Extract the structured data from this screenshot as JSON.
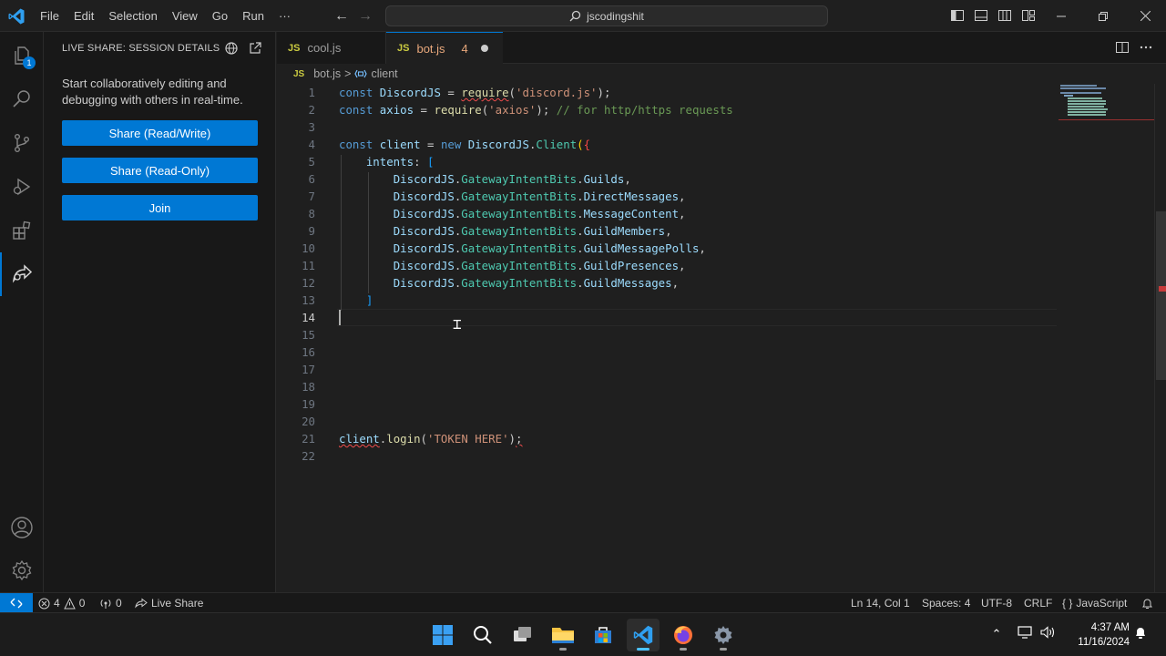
{
  "titlebar": {
    "menu": [
      "File",
      "Edit",
      "Selection",
      "View",
      "Go",
      "Run",
      "···"
    ],
    "search_text": "jscodingshit"
  },
  "activity": {
    "explorer_badge": "1"
  },
  "sidebar": {
    "title": "LIVE SHARE: SESSION DETAILS",
    "description": "Start collaboratively editing and debugging with others in real-time.",
    "buttons": [
      "Share (Read/Write)",
      "Share (Read-Only)",
      "Join"
    ]
  },
  "tabs": [
    {
      "icon": "JS",
      "label": "cool.js"
    },
    {
      "icon": "JS",
      "label": "bot.js",
      "count": "4"
    }
  ],
  "breadcrumb": {
    "file_icon": "JS",
    "file": "bot.js",
    "separator": ">",
    "symbol": "client"
  },
  "editor": {
    "line_numbers": [
      "1",
      "2",
      "3",
      "4",
      "5",
      "6",
      "7",
      "8",
      "9",
      "10",
      "11",
      "12",
      "13",
      "14",
      "15",
      "16",
      "17",
      "18",
      "19",
      "20",
      "21",
      "22"
    ],
    "current_line": 14
  },
  "statusbar": {
    "errors": "4",
    "warnings": "0",
    "ports": "0",
    "live_share": "Live Share",
    "position": "Ln 14, Col 1",
    "spaces": "Spaces: 4",
    "encoding": "UTF-8",
    "eol": "CRLF",
    "language": "JavaScript"
  },
  "taskbar": {
    "time": "4:37 AM",
    "date": "11/16/2024",
    "apps": [
      "windows-start-icon",
      "search-icon",
      "task-view-icon",
      "file-explorer-icon",
      "store-icon",
      "vscode-icon",
      "firefox-icon",
      "settings-icon"
    ]
  },
  "colors": {
    "accent": "#0078d4",
    "background": "#1f1f1f",
    "sidebar": "#181818"
  }
}
